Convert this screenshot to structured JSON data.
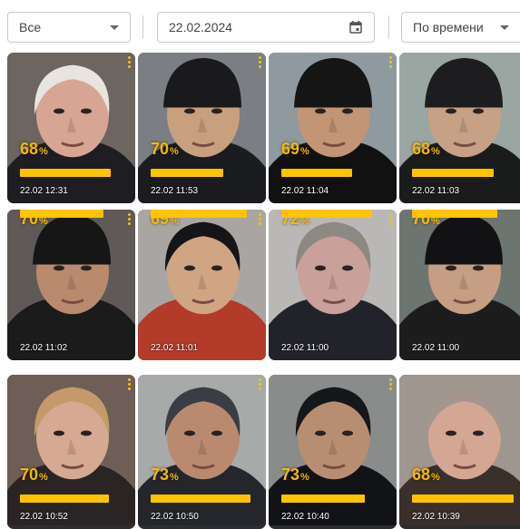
{
  "toolbar": {
    "filter_value": "Все",
    "date_value": "22.02.2024",
    "sort_value": "По времени"
  },
  "cards": [
    {
      "percent": "68",
      "time": "22.02 12:31"
    },
    {
      "percent": "70",
      "time": "22.02 11:53"
    },
    {
      "percent": "69",
      "time": "22.02 11:04"
    },
    {
      "percent": "68",
      "time": "22.02 11:03"
    },
    {
      "percent": "70",
      "time": "22.02 11:02"
    },
    {
      "percent": "69",
      "time": "22.02 11:01"
    },
    {
      "percent": "72",
      "time": "22.02 11:00"
    },
    {
      "percent": "70",
      "time": "22.02 11:00"
    },
    {
      "percent": "70",
      "time": "22.02 10:52"
    },
    {
      "percent": "73",
      "time": "22.02 10:50"
    },
    {
      "percent": "73",
      "time": "22.02 10:40"
    },
    {
      "percent": "68",
      "time": "22.02 10:39"
    }
  ],
  "percent_suffix": "%",
  "icons": {
    "filter_caret": "chevron-down-icon",
    "calendar": "calendar-icon",
    "sort_caret": "chevron-down-icon",
    "card_menu": "more-vertical-icon"
  },
  "colors": {
    "accent": "#f6b800",
    "redaction_bar": "#ffc400"
  }
}
